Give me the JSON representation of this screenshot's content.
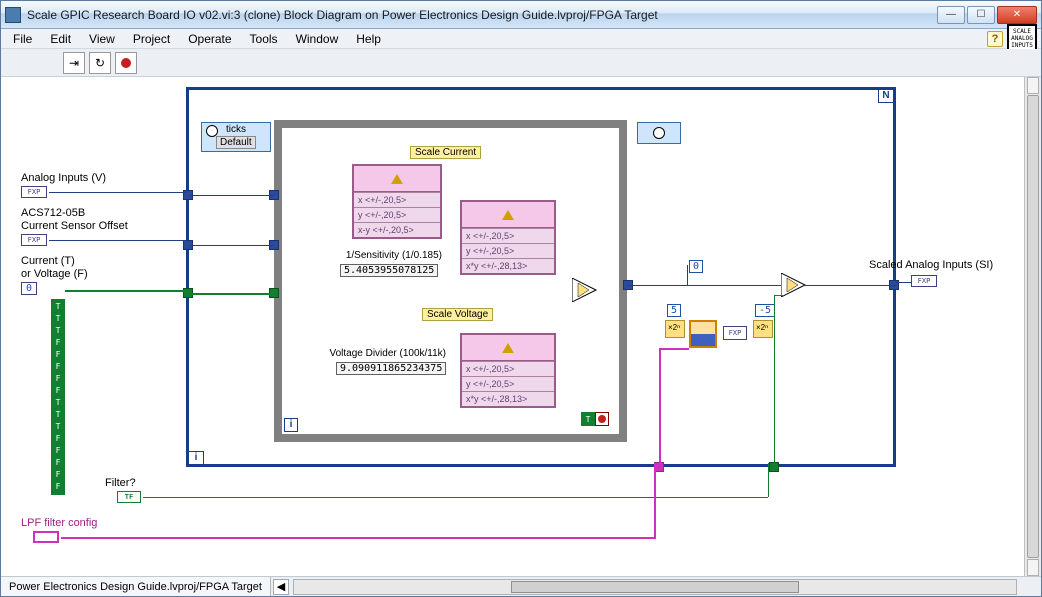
{
  "window": {
    "title": "Scale GPIC Research Board IO v02.vi:3 (clone) Block Diagram on Power Electronics Design Guide.lvproj/FPGA Target",
    "min": "—",
    "max": "☐",
    "close": "✕"
  },
  "menu": {
    "file": "File",
    "edit": "Edit",
    "view": "View",
    "project": "Project",
    "operate": "Operate",
    "tools": "Tools",
    "window": "Window",
    "help": "Help",
    "help_icon": "?",
    "badge": "SCALE\nANALOG\nINPUTS"
  },
  "status": {
    "path": "Power Electronics Design Guide.lvproj/FPGA Target",
    "nav": "◀"
  },
  "terminals": {
    "analog_in": "Analog Inputs (V)",
    "sensor1": "ACS712-05B",
    "sensor2": "Current Sensor Offset",
    "curr_t": "Current (T)",
    "or_volt": "or Voltage (F)",
    "zero": "0",
    "filter": "Filter?",
    "lpf": "LPF filter config",
    "out": "Scaled Analog Inputs (SI)",
    "fxp": "FXP",
    "tf": "TF"
  },
  "loop": {
    "n": "N",
    "i": "i",
    "ticks": "ticks",
    "default": "Default"
  },
  "inner": {
    "scale_current": "Scale Current",
    "scale_voltage": "Scale Voltage",
    "sens_label": "1/Sensitivity (1/0.185)",
    "sens_val": "5.4053955078125",
    "vdiv_label": "Voltage Divider (100k/11k)",
    "vdiv_val": "9.090911865234375",
    "row_x": "x <+/-,20,5>",
    "row_y": "y <+/-,20,5>",
    "row_xmy": "x-y <+/-,20,5>",
    "row_xy28": "x*y <+/-,28,13>",
    "inner_i": "i"
  },
  "consts": {
    "c0": "0",
    "c5": "5",
    "cm5": "-5",
    "fxp": "FXP"
  },
  "bools": [
    "T",
    "T",
    "T",
    "F",
    "F",
    "F",
    "F",
    "F",
    "T",
    "T",
    "T",
    "F",
    "F",
    "F",
    "F",
    "F"
  ]
}
